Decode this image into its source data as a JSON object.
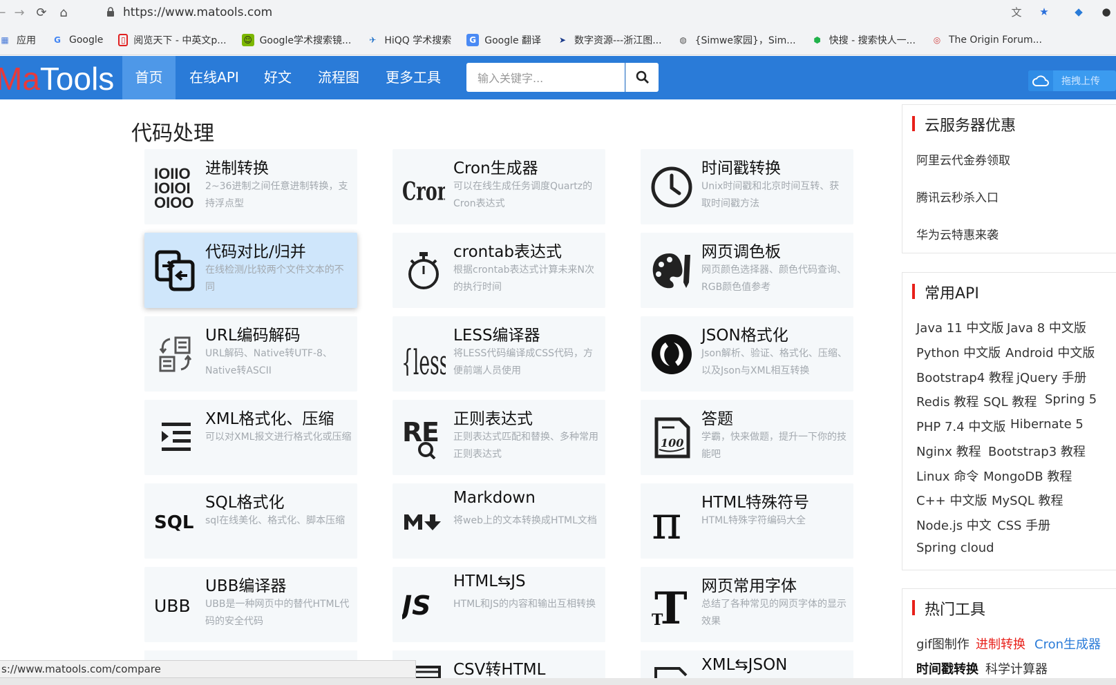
{
  "browser": {
    "url": "https://www.matools.com",
    "bookmarks": [
      {
        "label": "应用",
        "icon": "apps-grid-icon"
      },
      {
        "label": "Google",
        "icon": "google-g-icon"
      },
      {
        "label": "阅览天下 - 中英文p...",
        "icon": "bookmark-red-icon"
      },
      {
        "label": "Google学术搜索镜...",
        "icon": "android-icon"
      },
      {
        "label": "HiQQ 学术搜索",
        "icon": "bird-icon"
      },
      {
        "label": "Google 翻译",
        "icon": "translate-icon"
      },
      {
        "label": "数字资源---浙江图...",
        "icon": "library-icon"
      },
      {
        "label": "{Simwe家园}，Sim...",
        "icon": "globe-icon"
      },
      {
        "label": "快搜 - 搜索快人一...",
        "icon": "kuaisou-icon"
      },
      {
        "label": "The Origin Forum...",
        "icon": "origin-icon"
      }
    ],
    "status_url": "s://www.matools.com/compare"
  },
  "site": {
    "logo_ma": "Ma",
    "logo_tools": "Tools",
    "nav": [
      "首页",
      "在线API",
      "好文",
      "流程图",
      "更多工具"
    ],
    "search_placeholder": "输入关键字...",
    "upload_label": "拖拽上传"
  },
  "main": {
    "section_title": "代码处理",
    "cards": [
      {
        "title": "进制转换",
        "desc": "2~36进制之间任意进制转换，支持浮点型",
        "icon": "binary-icon"
      },
      {
        "title": "Cron生成器",
        "desc": "可以在线生成任务调度Quartz的Cron表达式",
        "icon": "cron-icon"
      },
      {
        "title": "时间戳转换",
        "desc": "Unix时间戳和北京时间互转、获取时间戳方法",
        "icon": "clock-icon"
      },
      {
        "title": "代码对比/归并",
        "desc": "在线检测/比较两个文件文本的不同",
        "icon": "compare-icon"
      },
      {
        "title": "crontab表达式",
        "desc": "根据crontab表达式计算未来N次的执行时间",
        "icon": "stopwatch-icon"
      },
      {
        "title": "网页调色板",
        "desc": "网页颜色选择器、颜色代码查询、RGB颜色值参考",
        "icon": "palette-icon"
      },
      {
        "title": "URL编码解码",
        "desc": "URL解码、Native转UTF-8、Native转ASCII",
        "icon": "url-convert-icon"
      },
      {
        "title": "LESS编译器",
        "desc": "将LESS代码编译成CSS代码，方便前端人员使用",
        "icon": "less-icon"
      },
      {
        "title": "JSON格式化",
        "desc": "Json解析、验证、格式化、压缩、以及Json与XML相互转换",
        "icon": "json-icon"
      },
      {
        "title": "XML格式化、压缩",
        "desc": "可以对XML报文进行格式化或压缩",
        "icon": "indent-icon"
      },
      {
        "title": "正则表达式",
        "desc": "正则表达式匹配和替换、多种常用正则表达式",
        "icon": "regex-icon"
      },
      {
        "title": "答题",
        "desc": "学霸，快来做题，提升一下你的技能吧",
        "icon": "exam-icon"
      },
      {
        "title": "SQL格式化",
        "desc": "sql在线美化、格式化、脚本压缩",
        "icon": "sql-icon"
      },
      {
        "title": "Markdown",
        "desc": "将web上的文本转换成HTML文档",
        "icon": "markdown-icon"
      },
      {
        "title": "HTML特殊符号",
        "desc": "HTML特殊字符编码大全",
        "icon": "pi-icon"
      },
      {
        "title": "UBB编译器",
        "desc": "UBB是一种网页中的替代HTML代码的安全代码",
        "icon": "ubb-icon"
      },
      {
        "title": "HTML⇆JS",
        "desc": "HTML和JS的内容和输出互相转换",
        "icon": "js-icon"
      },
      {
        "title": "网页常用字体",
        "desc": "总结了各种常见的网页字体的显示效果",
        "icon": "font-icon"
      }
    ],
    "partial_cards": [
      "CSV转HTML",
      "XML⇆JSON"
    ]
  },
  "sidebar": {
    "cloud_title": "云服务器优惠",
    "cloud_links": [
      "阿里云代金券领取",
      "腾讯云秒杀入口",
      "华为云特惠来袭"
    ],
    "api_title": "常用API",
    "api_rows": [
      [
        "Java 11 中文版",
        "Java 8 中文版"
      ],
      [
        "Python 中文版",
        "Android 中文版"
      ],
      [
        "Bootstrap4 教程",
        "jQuery 手册"
      ],
      [
        "Redis 教程",
        "SQL 教程",
        "Spring 5"
      ],
      [
        "PHP 7.4 中文版",
        "Hibernate 5"
      ],
      [
        "Nginx 教程",
        "Bootstrap3 教程"
      ],
      [
        "Linux 命令",
        "MongoDB 教程"
      ],
      [
        "C++ 中文版",
        "MySQL 教程"
      ],
      [
        "Node.js 中文",
        "CSS 手册"
      ],
      [
        "Spring cloud"
      ]
    ],
    "hot_title": "热门工具",
    "hot_row1": [
      "gif图制作",
      "进制转换",
      "Cron生成器"
    ],
    "hot_row2": [
      "时间戳转换",
      "科学计算器"
    ],
    "hot_colors": {
      "red": "#e8201a",
      "blue": "#2a7bd8"
    }
  }
}
